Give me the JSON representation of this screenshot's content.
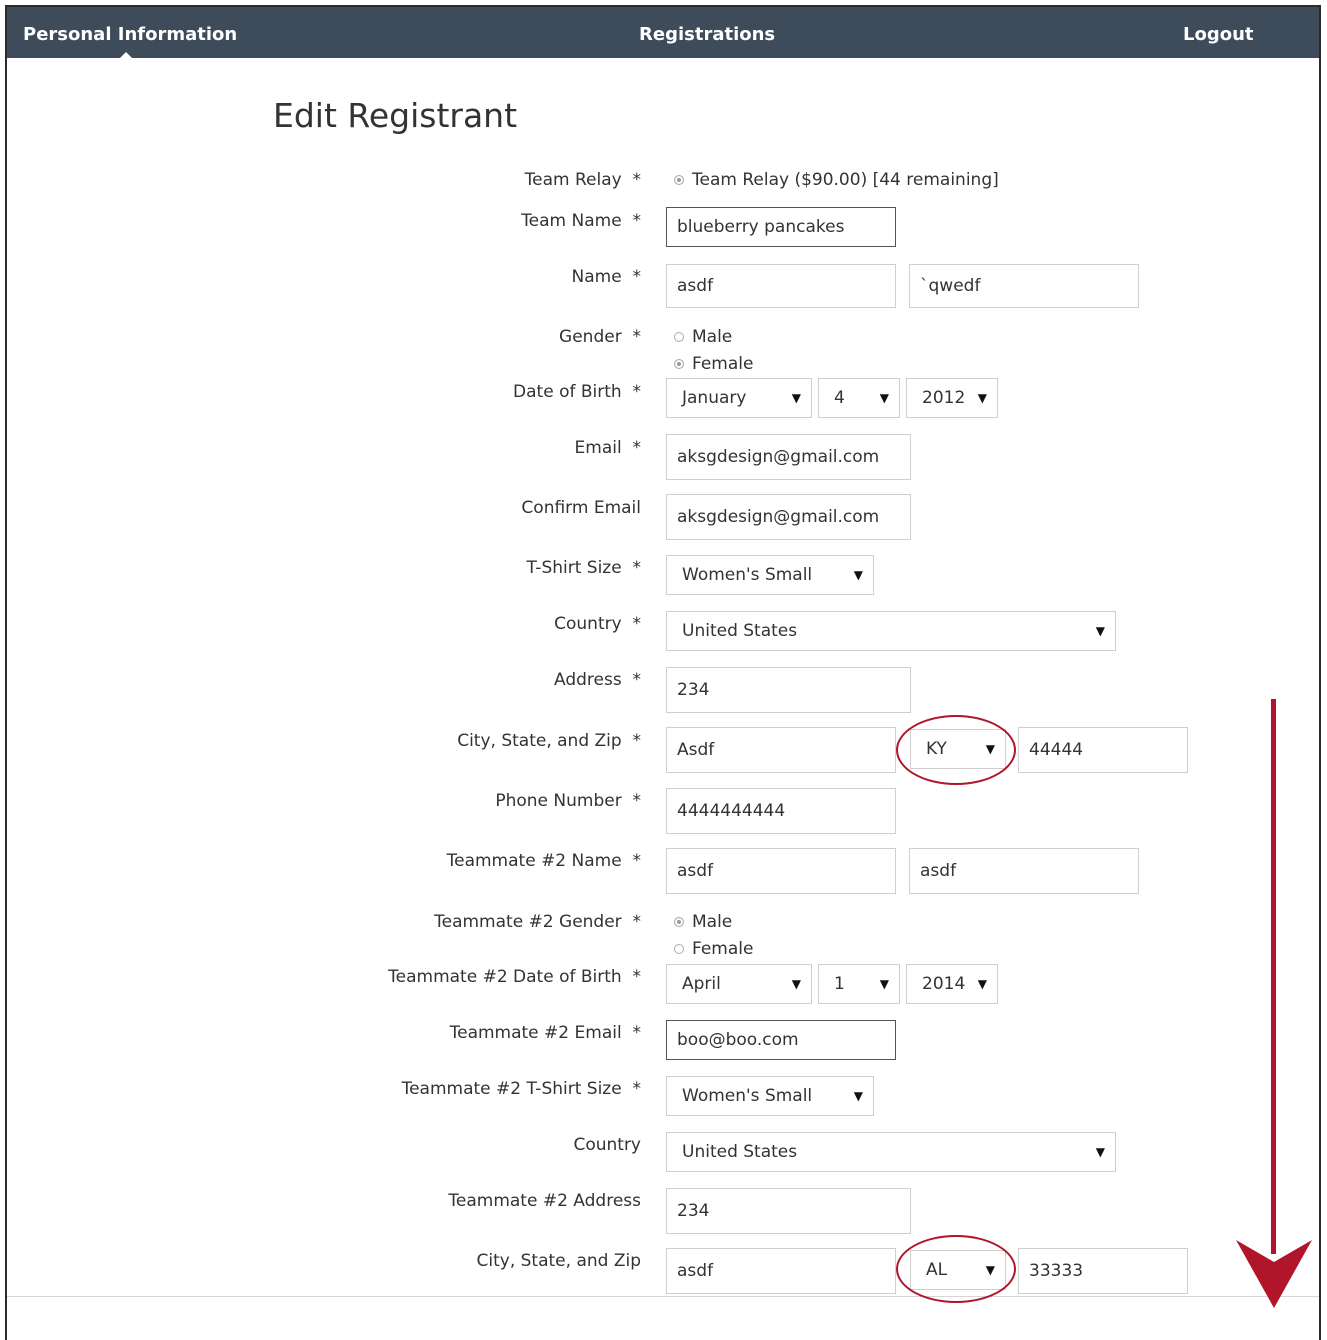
{
  "nav": {
    "personal_information": "Personal Information",
    "registrations": "Registrations",
    "logout": "Logout"
  },
  "page_title": "Edit Registrant",
  "form": {
    "team_relay": {
      "label": "Team Relay",
      "required": "*",
      "option": "Team Relay ($90.00) [44 remaining]"
    },
    "team_name": {
      "label": "Team Name",
      "required": "*",
      "value": "blueberry pancakes"
    },
    "name": {
      "label": "Name",
      "required": "*",
      "first": "asdf",
      "last": "`qwedf"
    },
    "gender": {
      "label": "Gender",
      "required": "*",
      "options": [
        "Male",
        "Female"
      ],
      "selected": "Female"
    },
    "dob": {
      "label": "Date of Birth",
      "required": "*",
      "month": "January",
      "day": "4",
      "year": "2012"
    },
    "email": {
      "label": "Email",
      "required": "*",
      "value": "aksgdesign@gmail.com"
    },
    "confirm_email": {
      "label": "Confirm Email",
      "value": "aksgdesign@gmail.com"
    },
    "tshirt": {
      "label": "T-Shirt Size",
      "required": "*",
      "value": "Women's Small"
    },
    "country": {
      "label": "Country",
      "required": "*",
      "value": "United States"
    },
    "address": {
      "label": "Address",
      "required": "*",
      "value": "234"
    },
    "city_state_zip": {
      "label": "City, State, and Zip",
      "required": "*",
      "city": "Asdf",
      "state": "KY",
      "zip": "44444"
    },
    "phone": {
      "label": "Phone Number",
      "required": "*",
      "value": "4444444444"
    },
    "tm2_name": {
      "label": "Teammate #2 Name",
      "required": "*",
      "first": "asdf",
      "last": "asdf"
    },
    "tm2_gender": {
      "label": "Teammate #2 Gender",
      "required": "*",
      "options": [
        "Male",
        "Female"
      ],
      "selected": "Male"
    },
    "tm2_dob": {
      "label": "Teammate #2 Date of Birth",
      "required": "*",
      "month": "April",
      "day": "1",
      "year": "2014"
    },
    "tm2_email": {
      "label": "Teammate #2 Email",
      "required": "*",
      "value": "boo@boo.com"
    },
    "tm2_tshirt": {
      "label": "Teammate #2 T-Shirt Size",
      "required": "*",
      "value": "Women's Small"
    },
    "tm2_country": {
      "label": "Country",
      "value": "United States"
    },
    "tm2_address": {
      "label": "Teammate #2 Address",
      "value": "234"
    },
    "tm2_city_state_zip": {
      "label": "City, State, and Zip",
      "city": "asdf",
      "state": "AL",
      "zip": "33333"
    }
  },
  "colors": {
    "nav_bg": "#3d4b5a",
    "annotation": "#b0152a"
  }
}
